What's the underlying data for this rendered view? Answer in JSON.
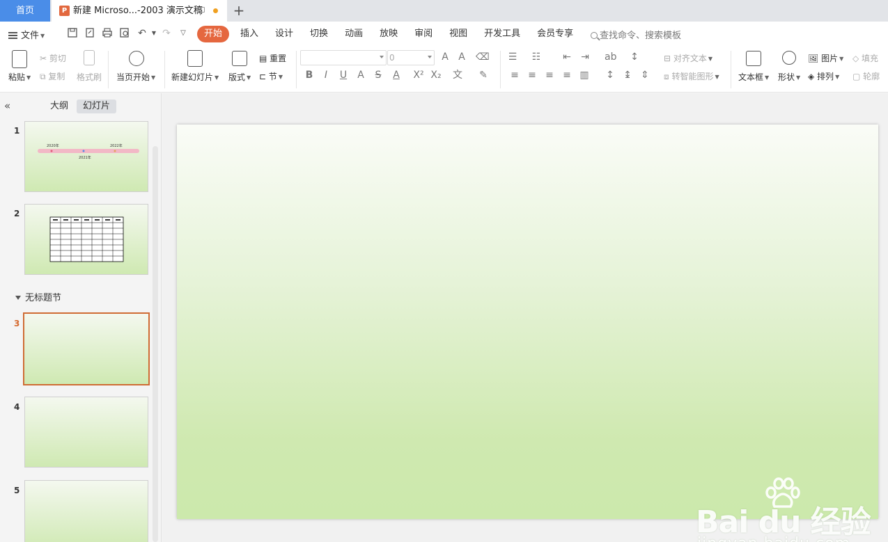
{
  "tabs": {
    "home_label": "首页",
    "doc_title": "新建 Microso...-2003 演示文稿",
    "doc_icon_letter": "P",
    "add_label": "+"
  },
  "menu": {
    "file_label": "文件",
    "tabs": [
      "开始",
      "插入",
      "设计",
      "切换",
      "动画",
      "放映",
      "审阅",
      "视图",
      "开发工具",
      "会员专享"
    ],
    "search_placeholder": "查找命令、搜索模板"
  },
  "ribbon": {
    "paste": "粘贴",
    "cut": "剪切",
    "copy": "复制",
    "format_painter": "格式刷",
    "start_from_current": "当页开始",
    "new_slide": "新建幻灯片",
    "layout": "版式",
    "reset": "重置",
    "section": "节",
    "font_size": "0",
    "align_text": "对齐文本",
    "smart_art": "转智能图形",
    "text_box": "文本框",
    "shape": "形状",
    "picture": "图片",
    "arrange": "排列",
    "fill": "填充",
    "outline": "轮廓"
  },
  "panel": {
    "outline_tab": "大纲",
    "slides_tab": "幻灯片",
    "section_title": "无标题节",
    "slide_numbers": [
      "1",
      "2",
      "3",
      "4",
      "5"
    ],
    "selected_slide": 3
  },
  "thumb1": {
    "left_label": "2020年",
    "right_label": "2022年",
    "mid_label": "2021年"
  },
  "watermark": {
    "brand": "Bai  du 经验",
    "url": "jingyan.baidu.com"
  },
  "colors": {
    "accent_orange": "#e5673f",
    "home_tab_blue": "#4a8de8",
    "slide_gradient_top": "#fafcf7",
    "slide_gradient_bottom": "#cce9ac"
  }
}
